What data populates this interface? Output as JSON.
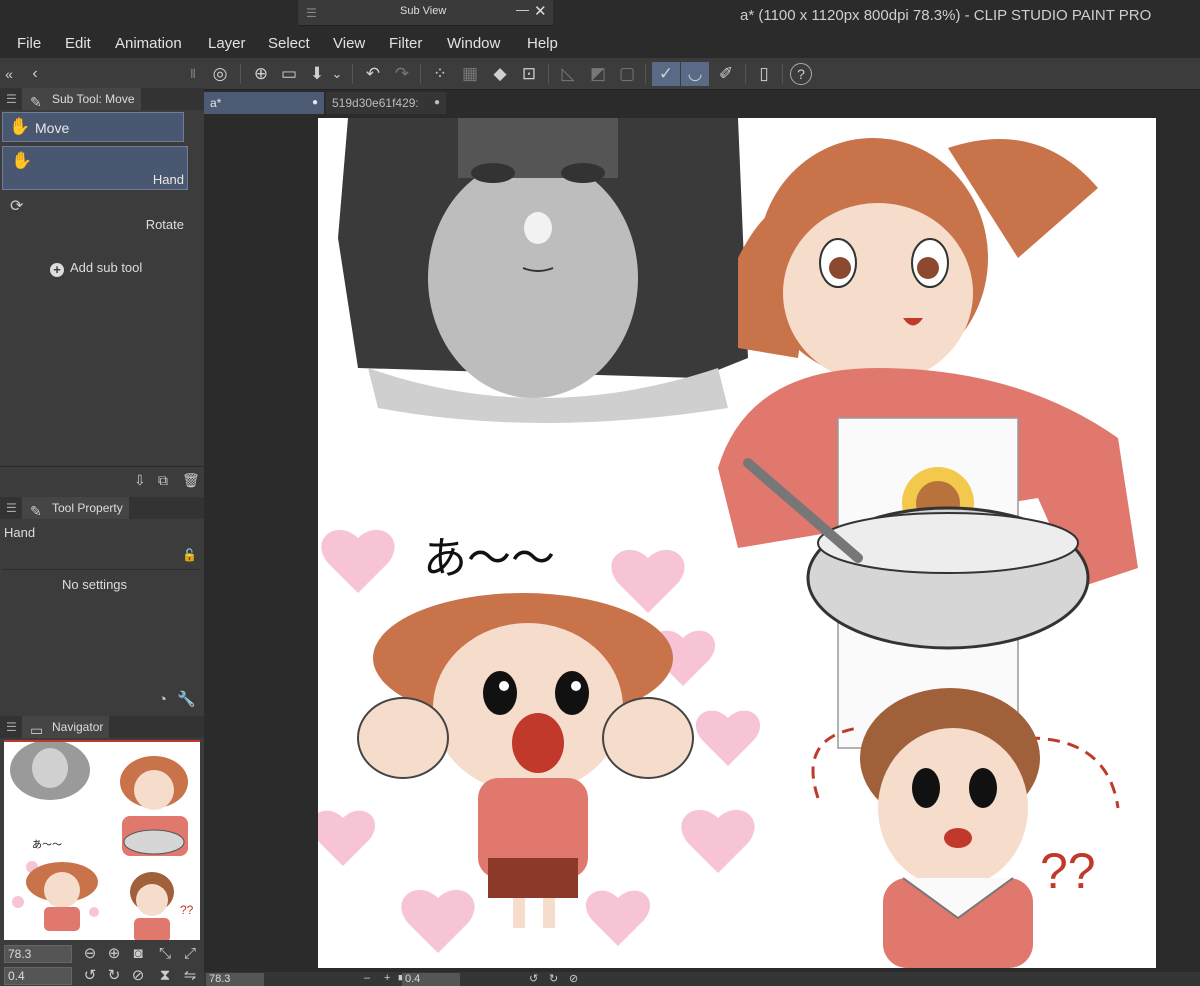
{
  "window": {
    "app_title": "a* (1100 x 1120px 800dpi 78.3%)  - CLIP STUDIO PAINT PRO",
    "subview_title": "Sub View",
    "subview_min": "—",
    "subview_close": "✕",
    "subview_grip": "☰"
  },
  "menu": [
    "File",
    "Edit",
    "Animation",
    "Layer",
    "Select",
    "View",
    "Filter",
    "Window",
    "Help"
  ],
  "panel_controls": {
    "collapse": "«",
    "back": "‹",
    "grip": "⦀"
  },
  "toolbar_icons": [
    {
      "name": "clip-studio-icon",
      "glyph": "◎"
    },
    {
      "name": "new-document-icon",
      "glyph": "⊕"
    },
    {
      "name": "open-folder-icon",
      "glyph": "▭"
    },
    {
      "name": "save-icon",
      "glyph": "⬇"
    },
    {
      "name": "save-dropdown-icon",
      "glyph": "⌄"
    },
    {
      "name": "undo-icon",
      "glyph": "↶"
    },
    {
      "name": "redo-icon",
      "glyph": "↷"
    },
    {
      "name": "clear-selection-icon",
      "glyph": "⁘"
    },
    {
      "name": "invert-selection-icon",
      "glyph": "▦"
    },
    {
      "name": "fill-selection-icon",
      "glyph": "◆"
    },
    {
      "name": "transform-icon",
      "glyph": "⊡"
    },
    {
      "name": "ruler-icon",
      "glyph": "◺"
    },
    {
      "name": "perspective-icon",
      "glyph": "◩"
    },
    {
      "name": "frame-icon",
      "glyph": "▢"
    },
    {
      "name": "snap-ruler-icon",
      "glyph": "✓"
    },
    {
      "name": "snap-special-ruler-icon",
      "glyph": "◡"
    },
    {
      "name": "snap-grid-icon",
      "glyph": "✐"
    },
    {
      "name": "device-icon",
      "glyph": "▯"
    },
    {
      "name": "help-icon",
      "glyph": "?"
    }
  ],
  "subtool_panel": {
    "title": "Sub Tool: Move",
    "items": [
      {
        "label": "Move",
        "icon": "✋"
      },
      {
        "label": "Hand",
        "icon": "✋"
      },
      {
        "label": "Rotate",
        "icon": "⟳"
      }
    ],
    "add_label": "Add sub tool",
    "add_glyph": "+",
    "footer_icons": [
      "⇩",
      "⧉",
      "🗑"
    ]
  },
  "tool_property_panel": {
    "title": "Tool Property",
    "tool_name": "Hand",
    "lock_icon": "🔓",
    "empty_text": "No settings",
    "footer_icons": [
      "◔",
      "🔧"
    ]
  },
  "navigator_panel": {
    "title": "Navigator",
    "zoom_value": "78.3",
    "angle_value": "0.4",
    "zoom_buttons": [
      "⊖",
      "⊕",
      "◙",
      "⤡",
      "⤢"
    ],
    "rotate_buttons": [
      "↺",
      "↻",
      "⊘",
      "⧗",
      "⇋"
    ]
  },
  "document_tabs": [
    {
      "label": "a*",
      "active": true,
      "dot": "●"
    },
    {
      "label": "519d30e61f429:",
      "active": false,
      "dot": "●"
    }
  ],
  "canvas": {
    "handwritten_text": "あ〜〜",
    "question_marks": "??"
  },
  "bottom_bar": {
    "zoom_value": "78.3",
    "angle_value": "0.4",
    "icons": [
      "–",
      "+",
      "■",
      "↺",
      "↻",
      "⊘"
    ]
  },
  "colors": {
    "panel": "#3c3c3c",
    "background": "#2b2b2b",
    "selection": "#4a5770",
    "skin": "#f6dccb",
    "hair": "#c8734a",
    "uniform": "#e0786e",
    "heart": "#f7c4d6"
  }
}
